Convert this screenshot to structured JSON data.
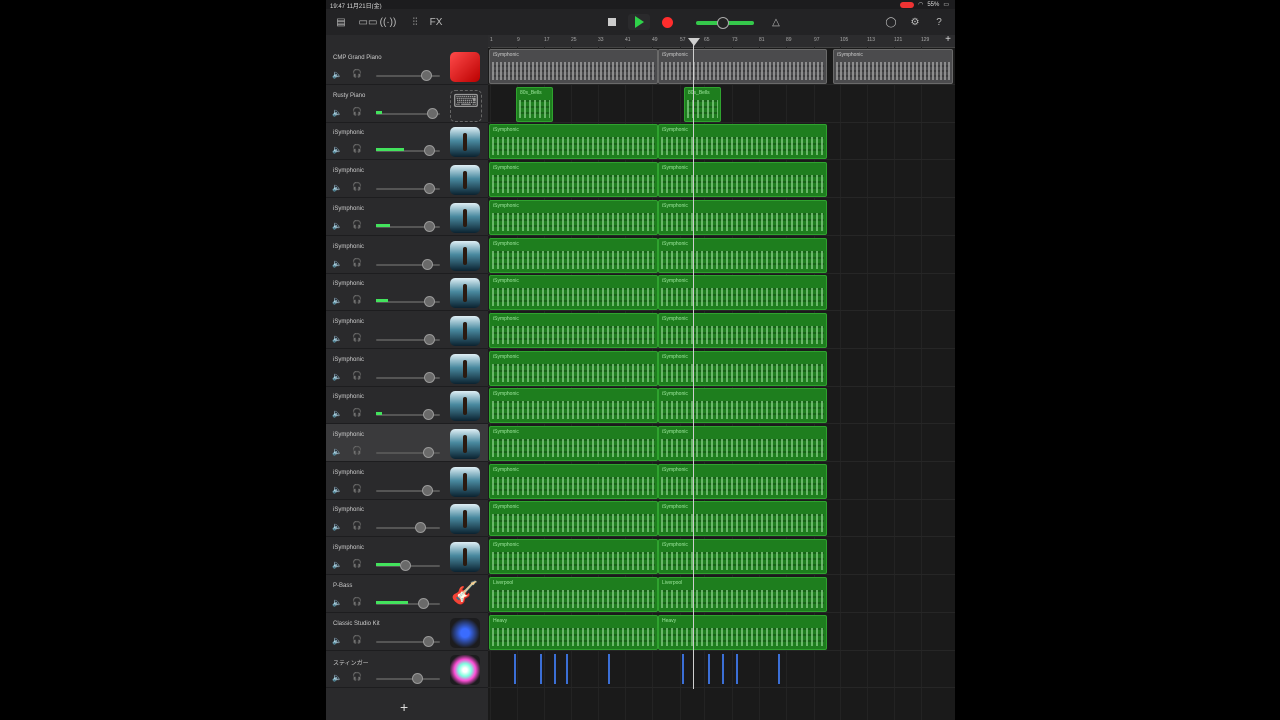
{
  "statusbar": {
    "time": "19:47",
    "date": "11月21日(金)",
    "battery": "55%"
  },
  "toolbar": {
    "fx_label": "FX"
  },
  "tracks": [
    {
      "name": "CMP Grand Piano",
      "icon": "grand-piano-icon",
      "muted": true
    },
    {
      "name": "Rusty Piano",
      "icon": "rusty-piano-icon",
      "muted": false
    },
    {
      "name": "iSymphonic",
      "icon": "orchestra-icon",
      "muted": false
    },
    {
      "name": "iSymphonic",
      "icon": "orchestra-icon",
      "muted": false
    },
    {
      "name": "iSymphonic",
      "icon": "orchestra-icon",
      "muted": false
    },
    {
      "name": "iSymphonic",
      "icon": "orchestra-icon",
      "muted": false
    },
    {
      "name": "iSymphonic",
      "icon": "orchestra-icon",
      "muted": false
    },
    {
      "name": "iSymphonic",
      "icon": "orchestra-icon",
      "muted": false
    },
    {
      "name": "iSymphonic",
      "icon": "orchestra-icon",
      "muted": false
    },
    {
      "name": "iSymphonic",
      "icon": "orchestra-icon",
      "muted": false
    },
    {
      "name": "iSymphonic",
      "icon": "orchestra-icon",
      "muted": false
    },
    {
      "name": "iSymphonic",
      "icon": "orchestra-icon",
      "muted": false
    },
    {
      "name": "iSymphonic",
      "icon": "orchestra-icon",
      "muted": false
    },
    {
      "name": "iSymphonic",
      "icon": "orchestra-icon",
      "muted": false
    },
    {
      "name": "P-Bass",
      "icon": "bass-guitar-icon",
      "muted": false
    },
    {
      "name": "Classic Studio Kit",
      "icon": "drum-kit-icon",
      "muted": false
    },
    {
      "name": "スティンガー",
      "icon": "stinger-icon",
      "muted": false
    }
  ],
  "ruler": [
    "1",
    "9",
    "17",
    "25",
    "33",
    "41",
    "49",
    "57",
    "65",
    "73",
    "81",
    "89",
    "97",
    "105",
    "113",
    "121",
    "129"
  ],
  "region_labels": {
    "piano": "iSymphonic",
    "rusty": "80s_Bells",
    "orch": "iSymphonic",
    "bass": "Liverpool",
    "drums": "Heavy"
  }
}
